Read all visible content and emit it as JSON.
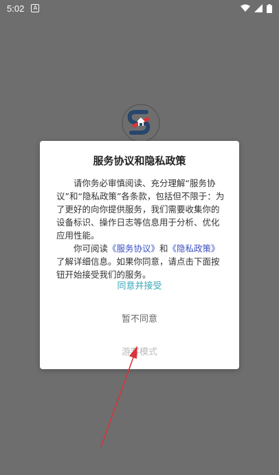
{
  "status_bar": {
    "time": "5:02",
    "notification_icon": "a-icon",
    "wifi_icon": "wifi-icon",
    "signal_icon": "signal-icon",
    "battery_icon": "battery-icon"
  },
  "background": {
    "logo_icon": "app-logo-icon"
  },
  "dialog": {
    "title": "服务协议和隐私政策",
    "paragraph1": "请你务必审慎阅读、充分理解“服务协议”和“隐私政策”各条款，包括但不限于：为了更好的向你提供服务，我们需要收集你的设备标识、操作日志等信息用于分析、优化应用性能。",
    "paragraph2_prefix": "你可阅读",
    "service_link": "《服务协议》",
    "paragraph2_and": "和",
    "privacy_link": "《隐私政策》",
    "paragraph2_suffix": "了解详细信息。如果你同意，请点击下面按钮开始接受我们的服务。",
    "agree_button": "同意并接受",
    "disagree_button": "暂不同意",
    "guest_button": "游客模式"
  },
  "colors": {
    "overlay": "#6e6e6e",
    "link": "#3b4fc4",
    "agree": "#3aa6b9",
    "arrow": "#d9343a"
  }
}
